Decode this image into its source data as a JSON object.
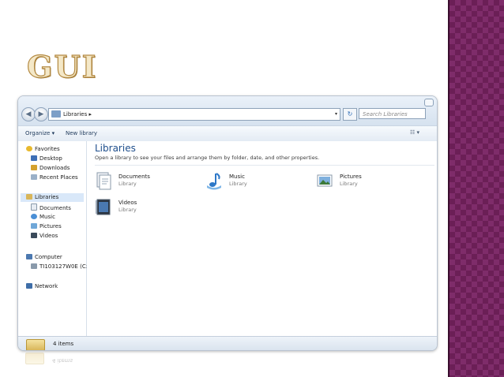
{
  "slide": {
    "title": "GUI"
  },
  "window": {
    "address_path": "Libraries",
    "address_drop": "▾",
    "refresh_glyph": "↻",
    "search_placeholder": "Search Libraries",
    "toolbar": {
      "organize": "Organize ▾",
      "new_library": "New library",
      "view_glyphs": "☷ ▾"
    },
    "sidebar": {
      "favorites": {
        "label": "Favorites",
        "items": [
          "Desktop",
          "Downloads",
          "Recent Places"
        ]
      },
      "libraries": {
        "label": "Libraries",
        "items": [
          "Documents",
          "Music",
          "Pictures",
          "Videos"
        ]
      },
      "computer": {
        "label": "Computer",
        "items": [
          "TI103127W0E (C:)"
        ]
      },
      "network": {
        "label": "Network"
      }
    },
    "content": {
      "title": "Libraries",
      "description": "Open a library to see your files and arrange them by folder, date, and other properties.",
      "libraries": [
        {
          "name": "Documents",
          "type": "Library",
          "icon": "documents-library-icon"
        },
        {
          "name": "Music",
          "type": "Library",
          "icon": "music-library-icon"
        },
        {
          "name": "Pictures",
          "type": "Library",
          "icon": "pictures-library-icon"
        },
        {
          "name": "Videos",
          "type": "Library",
          "icon": "videos-library-icon"
        }
      ]
    },
    "status": {
      "count_text": "4 items"
    }
  },
  "colors": {
    "accent": "#1e4e8c",
    "side_panel": "#6b1f56",
    "title_gold": "#b48a42"
  }
}
